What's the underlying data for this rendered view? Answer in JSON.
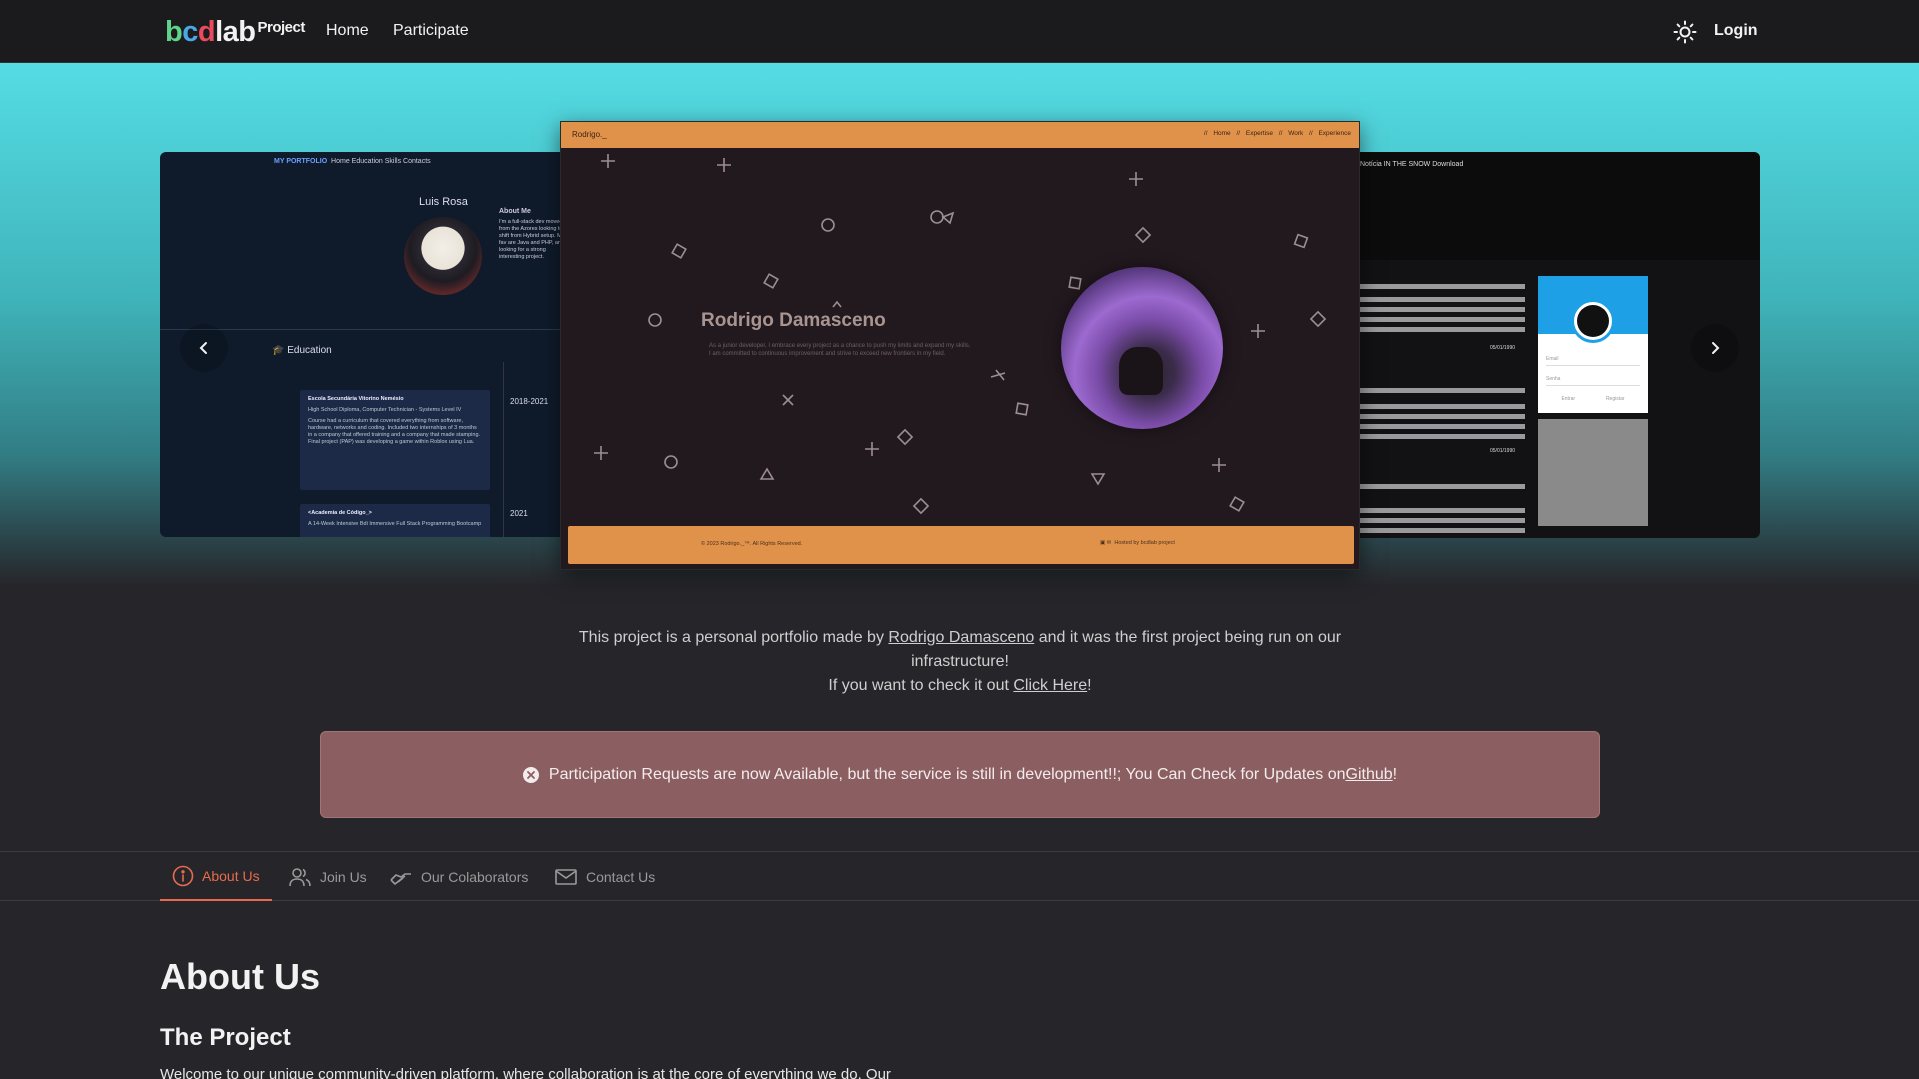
{
  "navbar": {
    "logo": {
      "b": "b",
      "c": "c",
      "d": "d",
      "lab": "lab",
      "suffix": "Project"
    },
    "links": [
      "Home",
      "Participate"
    ],
    "theme_icon": "sun-icon",
    "login": "Login"
  },
  "carousel": {
    "left_slide": {
      "nav_brand": "MY PORTFOLIO",
      "nav_links": "Home  Education  Skills  Contacts",
      "name": "Luis Rosa",
      "about_title": "About Me",
      "about_text": "I'm a full-stack dev moved from the Azores looking to shift from Hybrid setup. My fav are Java and PHP, and a looking for a strong interesting project.",
      "section": "Education",
      "card1_title": "Escola Secundária Vitorino Nemésio",
      "card1_sub": "High School Diploma, Computer Technician - Systems Level IV",
      "card1_text": "Course had a curriculum that covered everything from software, hardware, networks and coding. Included two internships of 3 months in a company that offered training and a company that made stamping. Final project (PAP) was developing a game within Roblox using Lua.",
      "card1_date": "2018-2021",
      "card2_title": "<Academia de Código_>",
      "card2_text": "A 14-Week Intensive Bdi Immersive Full Stack Programming Bootcamp",
      "card2_date": "2021"
    },
    "center_slide": {
      "brand": "Rodrigo._",
      "nav": "// Home  // Expertise  // Work  // Experience",
      "title": "Rodrigo Damasceno",
      "description": "As a junior developer, I embrace every project as a chance to push my limits and expand my skills. I am committed to continuous improvement and strive to exceed new frontiers in my field.",
      "footer_left": "© 2023 Rodrigo._™. All Rights Reserved.",
      "footer_right": "Hosted by bcdlab project"
    },
    "right_slide": {
      "nav": "Notícia   IN THE SNOW   Download",
      "date": "05/01/1990",
      "card_email": "Email",
      "card_pass": "Senha",
      "card_enter": "Entrar",
      "card_register": "Registar"
    },
    "prev_icon": "chevron-left-icon",
    "next_icon": "chevron-right-icon"
  },
  "intro": {
    "line1_prefix": "This project is a personal portfolio made by ",
    "author_link": "Rodrigo Damasceno",
    "line1_suffix": " and it was the first project being run on our infrastructure!",
    "line2_prefix": "If you want to check it out ",
    "click_link": "Click Here",
    "line2_suffix": "!"
  },
  "alert": {
    "icon": "x-circle-icon",
    "text": "Participation Requests are now Available, but the service is still in development!!; You Can Check for Updates on ",
    "link": "Github",
    "suffix": "!"
  },
  "tabs": [
    {
      "label": "About Us",
      "icon": "info-icon",
      "active": true
    },
    {
      "label": "Join Us",
      "icon": "users-icon",
      "active": false
    },
    {
      "label": "Our Colaborators",
      "icon": "handshake-icon",
      "active": false
    },
    {
      "label": "Contact Us",
      "icon": "envelope-icon",
      "active": false
    }
  ],
  "about": {
    "heading": "About Us",
    "subheading": "The Project",
    "paragraph": "Welcome to our unique community-driven platform, where collaboration is at the core of everything we do. Our"
  },
  "colors": {
    "accent": "#e86b4d",
    "alert_bg": "#8b5f62",
    "hero_top": "#55dce4",
    "portfolio_orange": "#e1924a"
  }
}
